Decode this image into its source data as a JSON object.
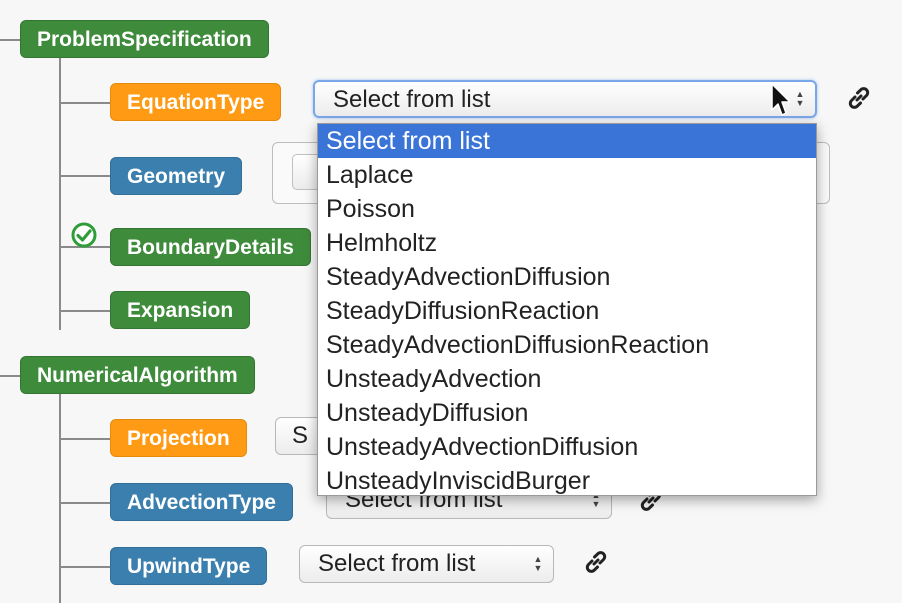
{
  "tree": {
    "problem_specification": "ProblemSpecification",
    "equation_type": "EquationType",
    "geometry": "Geometry",
    "boundary_details": "BoundaryDetails",
    "expansion": "Expansion",
    "numerical_algorithm": "NumericalAlgorithm",
    "projection": "Projection",
    "advection_type": "AdvectionType",
    "upwind_type": "UpwindType"
  },
  "selects": {
    "equation_type_value": "Select from list",
    "projection_value_partial": "S",
    "advection_type_value": "Select from list",
    "upwind_type_value": "Select from list"
  },
  "dropdown": {
    "options": [
      "Select from list",
      "Laplace",
      "Poisson",
      "Helmholtz",
      "SteadyAdvectionDiffusion",
      "SteadyDiffusionReaction",
      "SteadyAdvectionDiffusionReaction",
      "UnsteadyAdvection",
      "UnsteadyDiffusion",
      "UnsteadyAdvectionDiffusion",
      "UnsteadyInviscidBurger"
    ],
    "selected_index": 0
  },
  "colors": {
    "group_green": "#3f8b3c",
    "required_orange": "#fe9a13",
    "optional_blue": "#3a7fae",
    "highlight_blue": "#3a74d6",
    "check_green": "#2f9e3a"
  },
  "icons": {
    "link": "link-icon",
    "check": "check-circle-icon",
    "cursor": "mouse-pointer-icon"
  }
}
